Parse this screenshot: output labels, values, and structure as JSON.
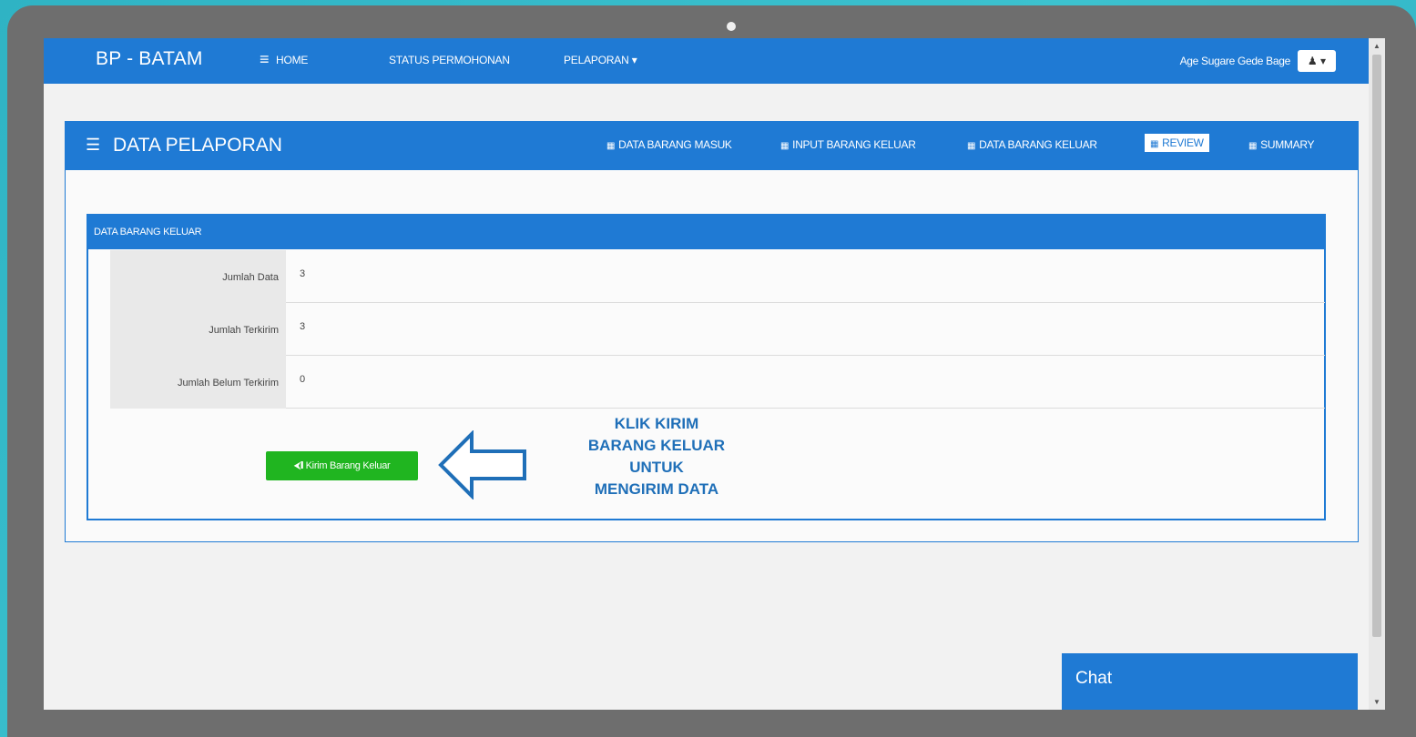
{
  "navbar": {
    "brand": "BP - BATAM",
    "menu_icon": "hamburger-icon",
    "links": [
      "HOME",
      "STATUS PERMOHONAN",
      "PELAPORAN ▾"
    ],
    "user_name": "Age Sugare Gede Bage",
    "user_button": "👤 ▾"
  },
  "panel": {
    "title": "DATA PELAPORAN",
    "title_icon": "list-icon",
    "tabs": [
      {
        "label": "DATA BARANG MASUK",
        "icon": "grid-icon",
        "active": false
      },
      {
        "label": "INPUT BARANG KELUAR",
        "icon": "grid-icon",
        "active": false
      },
      {
        "label": "DATA BARANG KELUAR",
        "icon": "grid-icon",
        "active": false
      },
      {
        "label": "REVIEW",
        "icon": "grid-icon",
        "active": true
      },
      {
        "label": "SUMMARY",
        "icon": "grid-icon",
        "active": false
      }
    ]
  },
  "section": {
    "title": "DATA BARANG KELUAR",
    "rows": [
      {
        "label": "Jumlah Data",
        "value": "3"
      },
      {
        "label": "Jumlah Terkirim",
        "value": "3"
      },
      {
        "label": "Jumlah Belum Terkirim",
        "value": "0"
      }
    ],
    "send_button": "⮜❙ Kirim Barang Keluar"
  },
  "callout": {
    "lines": [
      "KLIK KIRIM",
      "BARANG KELUAR",
      "UNTUK",
      "MENGIRIM DATA"
    ]
  },
  "chat": {
    "label": "Chat"
  },
  "colors": {
    "primary": "#1f7ad4",
    "button_green": "#20b520",
    "callout_text": "#1f6fb8"
  }
}
